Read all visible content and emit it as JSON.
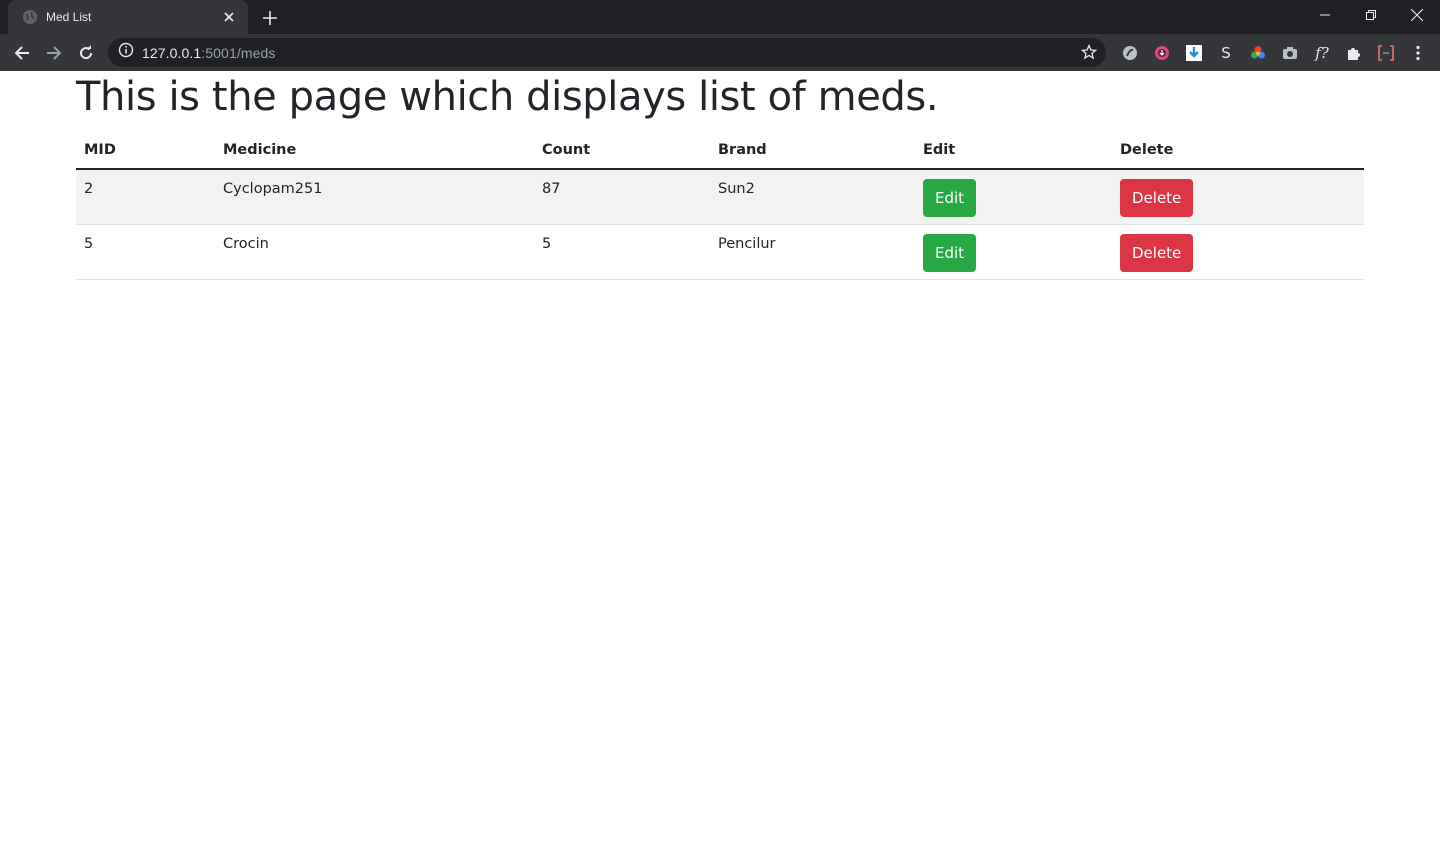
{
  "browser": {
    "tab_title": "Med List",
    "url_host": "127.0.0.1",
    "url_path": ":5001/meds"
  },
  "page": {
    "heading": "This is the page which displays list of meds."
  },
  "table": {
    "headers": [
      "MID",
      "Medicine",
      "Count",
      "Brand",
      "Edit",
      "Delete"
    ],
    "rows": [
      {
        "mid": "2",
        "medicine": "Cyclopam251",
        "count": "87",
        "brand": "Sun2",
        "edit_label": "Edit",
        "delete_label": "Delete"
      },
      {
        "mid": "5",
        "medicine": "Crocin",
        "count": "5",
        "brand": "Pencilur",
        "edit_label": "Edit",
        "delete_label": "Delete"
      }
    ]
  },
  "colors": {
    "edit_button": "#28a745",
    "delete_button": "#dc3545",
    "chrome_dark": "#202124",
    "chrome_toolbar": "#35363a"
  },
  "extensions": [
    "ext-s-icon",
    "ext-record-icon",
    "ext-download-icon",
    "ext-s-letter-icon",
    "ext-color-icon",
    "ext-camera-icon",
    "ext-function-icon",
    "puzzle-icon",
    "ext-bracket-icon",
    "menu-icon"
  ]
}
